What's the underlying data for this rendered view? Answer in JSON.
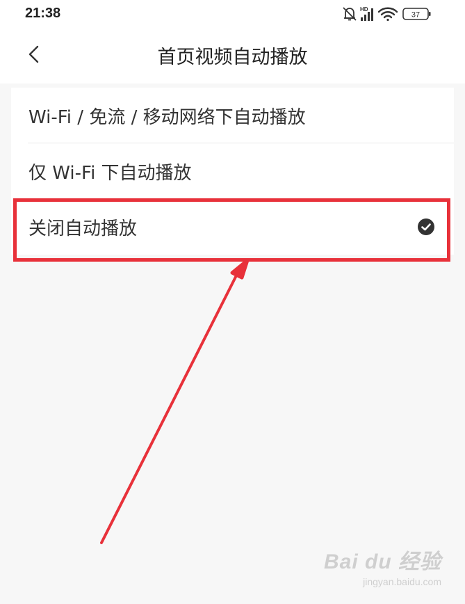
{
  "status_bar": {
    "time": "21:38",
    "hd_label": "HD",
    "battery": "37",
    "icons": [
      "bell-muted-icon",
      "signal-icon",
      "wifi-icon",
      "battery-icon"
    ]
  },
  "nav": {
    "title": "首页视频自动播放",
    "back_icon": "chevron-left-icon"
  },
  "options": [
    {
      "label": "Wi-Fi / 免流 / 移动网络下自动播放",
      "selected": false
    },
    {
      "label": "仅 Wi-Fi 下自动播放",
      "selected": false
    },
    {
      "label": "关闭自动播放",
      "selected": true
    }
  ],
  "annotation": {
    "color": "#e8313a"
  },
  "watermark": {
    "brand": "Bai du 经验",
    "site": "jingyan.baidu.com"
  }
}
